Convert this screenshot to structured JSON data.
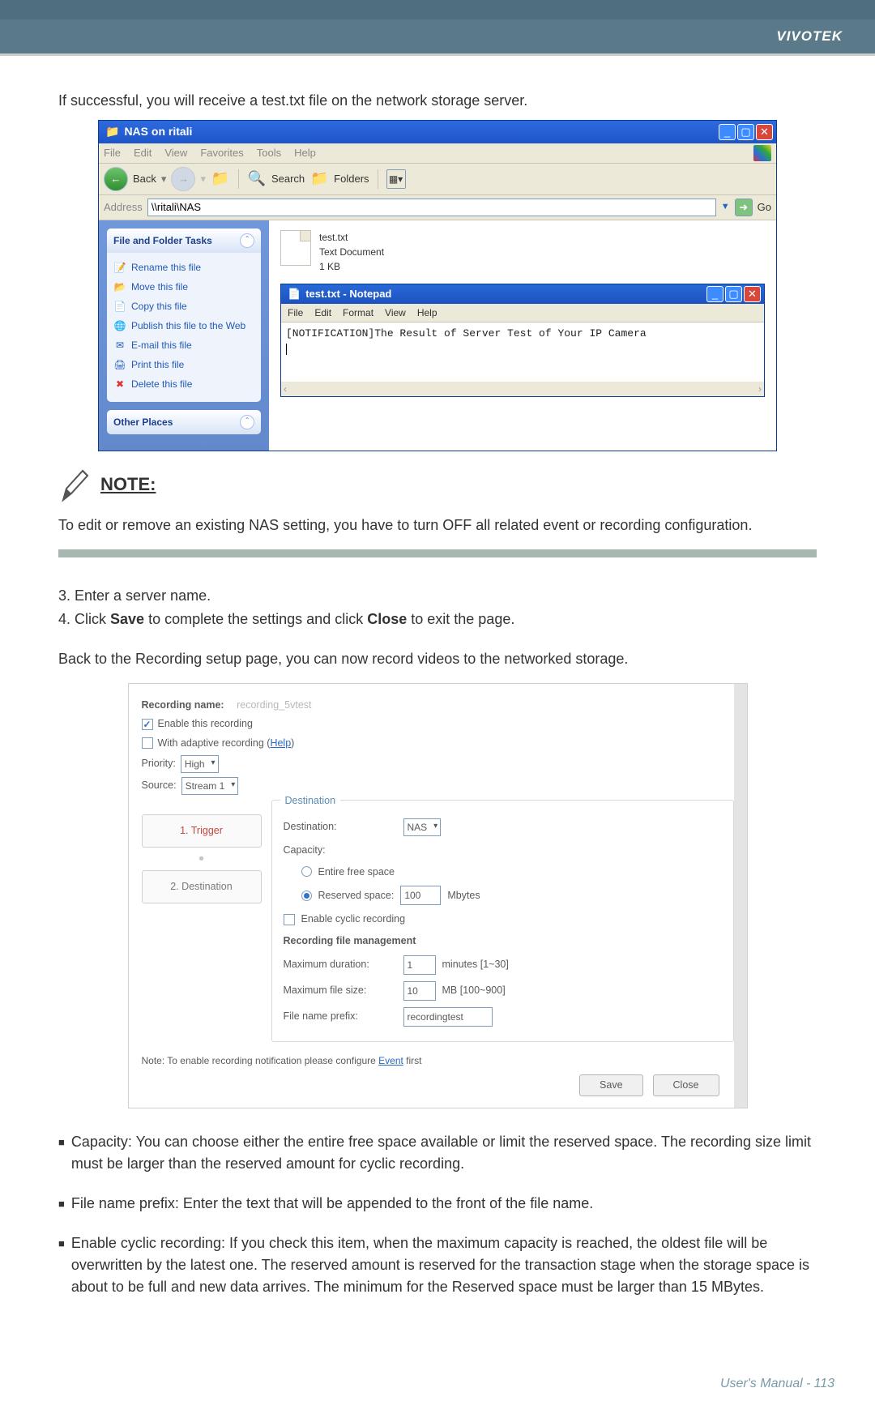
{
  "brand": "VIVOTEK",
  "success_text": "If successful, you will receive a test.txt file on the network storage server.",
  "win": {
    "title": "NAS on ritali",
    "menu": [
      "File",
      "Edit",
      "View",
      "Favorites",
      "Tools",
      "Help"
    ],
    "back": "Back",
    "search": "Search",
    "folders": "Folders",
    "address_label": "Address",
    "address_value": "\\\\ritali\\NAS",
    "go": "Go",
    "tasks_header": "File and Folder Tasks",
    "tasks": [
      "Rename this file",
      "Move this file",
      "Copy this file",
      "Publish this file to the Web",
      "E-mail this file",
      "Print this file",
      "Delete this file"
    ],
    "other_places": "Other Places",
    "file": {
      "name": "test.txt",
      "type": "Text Document",
      "size": "1 KB"
    },
    "notepad": {
      "title": "test.txt - Notepad",
      "menu": [
        "File",
        "Edit",
        "Format",
        "View",
        "Help"
      ],
      "content": "[NOTIFICATION]The Result of Server Test of Your IP Camera"
    }
  },
  "note_heading": "NOTE:",
  "note_text": "To edit or remove an existing NAS setting, you have to turn OFF all related event or recording configuration.",
  "step3": "3. Enter a server name.",
  "step4a": "4. Click ",
  "step4_save": "Save",
  "step4b": " to complete the settings and click ",
  "step4_close": "Close",
  "step4c": " to exit the page.",
  "back_line": "Back to the Recording setup page, you can now record videos to the networked storage.",
  "rec": {
    "name_label": "Recording name:",
    "name_val": "recording_5vtest",
    "enable": "Enable this recording",
    "adaptive1": "With adaptive recording (",
    "adaptive_help": "Help",
    "adaptive2": ")",
    "priority_label": "Priority:",
    "priority_val": "High",
    "source_label": "Source:",
    "source_val": "Stream 1",
    "step1": "1. Trigger",
    "step2": "2. Destination",
    "dest_legend": "Destination",
    "dest_label": "Destination:",
    "dest_val": "NAS",
    "capacity": "Capacity:",
    "entire": "Entire free space",
    "reserved": "Reserved space:",
    "reserved_val": "100",
    "mbytes": "Mbytes",
    "cyclic": "Enable cyclic recording",
    "mgmt": "Recording file management",
    "maxdur": "Maximum duration:",
    "maxdur_val": "1",
    "maxdur_unit": "minutes [1~30]",
    "maxsize": "Maximum file size:",
    "maxsize_val": "10",
    "maxsize_unit": "MB [100~900]",
    "prefix": "File name prefix:",
    "prefix_val": "recordingtest",
    "note1": "Note: To enable recording notification please configure ",
    "note_event": "Event",
    "note2": " first",
    "save": "Save",
    "close": "Close"
  },
  "bullet1": "Capacity: You can choose either the entire free space available or limit the reserved space. The recording size limit must be larger than the reserved amount for cyclic recording.",
  "bullet2": "File name prefix: Enter the text that will be appended to the front of the file name.",
  "bullet3": "Enable cyclic recording: If you check this item, when the maximum capacity is reached, the oldest file will be overwritten by the latest one. The reserved amount is reserved for the transaction stage when the storage space is about to be full and new data arrives. The minimum for the Reserved space must be larger than 15 MBytes.",
  "footer_um": "User's Manual - ",
  "footer_page": "113"
}
